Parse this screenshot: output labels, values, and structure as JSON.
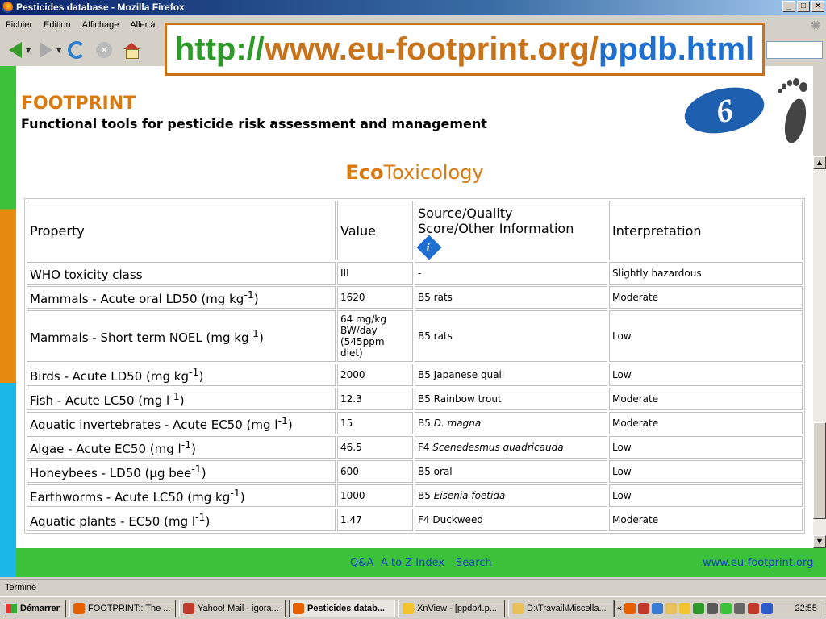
{
  "window": {
    "title": "Pesticides database - Mozilla Firefox",
    "minimize": "_",
    "maximize": "□",
    "close": "×"
  },
  "menu": [
    "Fichier",
    "Edition",
    "Affichage",
    "Aller à"
  ],
  "url_overlay": {
    "part1": "http://",
    "part2": "www.eu-footprint.org/",
    "part3": "ppdb.html"
  },
  "site": {
    "title": "FOOTPRINT",
    "subtitle": "Functional tools for pesticide risk assessment and management",
    "eu_logo": "6"
  },
  "heading": {
    "bold": "Eco",
    "rest": "Toxicology"
  },
  "table": {
    "headers": {
      "property": "Property",
      "value": "Value",
      "source_line1": "Source/Quality",
      "source_line2": "Score/Other Information",
      "info_icon": "i",
      "interpretation": "Interpretation"
    },
    "rows": [
      {
        "p1": "WHO toxicity class",
        "sup": "",
        "p2": "",
        "value": "III",
        "source": "-",
        "source_italic": "",
        "interp": "Slightly hazardous"
      },
      {
        "p1": "Mammals - Acute oral LD50 (mg kg",
        "sup": "-1",
        "p2": ")",
        "value": "1620",
        "source": "B5 rats",
        "source_italic": "",
        "interp": "Moderate"
      },
      {
        "p1": "Mammals - Short term NOEL (mg kg",
        "sup": "-1",
        "p2": ")",
        "value": "64 mg/kg BW/day (545ppm diet)",
        "source": "B5 rats",
        "source_italic": "",
        "interp": "Low"
      },
      {
        "p1": "Birds - Acute LD50 (mg kg",
        "sup": "-1",
        "p2": ")",
        "value": "2000",
        "source": "B5 Japanese quail",
        "source_italic": "",
        "interp": "Low"
      },
      {
        "p1": "Fish - Acute LC50 (mg l",
        "sup": "-1",
        "p2": ")",
        "value": "12.3",
        "source": "B5 Rainbow trout",
        "source_italic": "",
        "interp": "Moderate"
      },
      {
        "p1": "Aquatic invertebrates - Acute EC50 (mg l",
        "sup": "-1",
        "p2": ")",
        "value": "15",
        "source": "B5 ",
        "source_italic": "D. magna",
        "interp": "Moderate"
      },
      {
        "p1": "Algae - Acute EC50 (mg l",
        "sup": "-1",
        "p2": ")",
        "value": "46.5",
        "source": "F4 ",
        "source_italic": "Scenedesmus quadricauda",
        "interp": "Low"
      },
      {
        "p1": "Honeybees - LD50 (μg bee",
        "sup": "-1",
        "p2": ")",
        "value": "600",
        "source": "B5 oral",
        "source_italic": "",
        "interp": "Low"
      },
      {
        "p1": "Earthworms - Acute LC50 (mg kg",
        "sup": "-1",
        "p2": ")",
        "value": "1000",
        "source": "B5 ",
        "source_italic": "Eisenia foetida",
        "interp": "Low"
      },
      {
        "p1": "Aquatic plants - EC50 (mg l",
        "sup": "-1",
        "p2": ")",
        "value": "1.47",
        "source": "F4 Duckweed",
        "source_italic": "",
        "interp": "Moderate"
      }
    ]
  },
  "footer": {
    "qa": "Q&A",
    "az": "A to Z Index",
    "search": "Search",
    "site": "www.eu-footprint.org"
  },
  "status": "Terminé",
  "taskbar": {
    "start": "Démarrer",
    "tasks": [
      {
        "label": "FOOTPRINT:: The ...",
        "color": "#e66000",
        "active": false
      },
      {
        "label": "Yahoo! Mail - igora...",
        "color": "#c0392b",
        "active": false
      },
      {
        "label": "Pesticides datab...",
        "color": "#e66000",
        "active": true
      },
      {
        "label": "XnView - [ppdb4.p...",
        "color": "#f4c430",
        "active": false
      },
      {
        "label": "D:\\Travail\\Miscella...",
        "color": "#e8c15a",
        "active": false
      }
    ],
    "tray_chevron": "«",
    "clock": "22:55"
  }
}
